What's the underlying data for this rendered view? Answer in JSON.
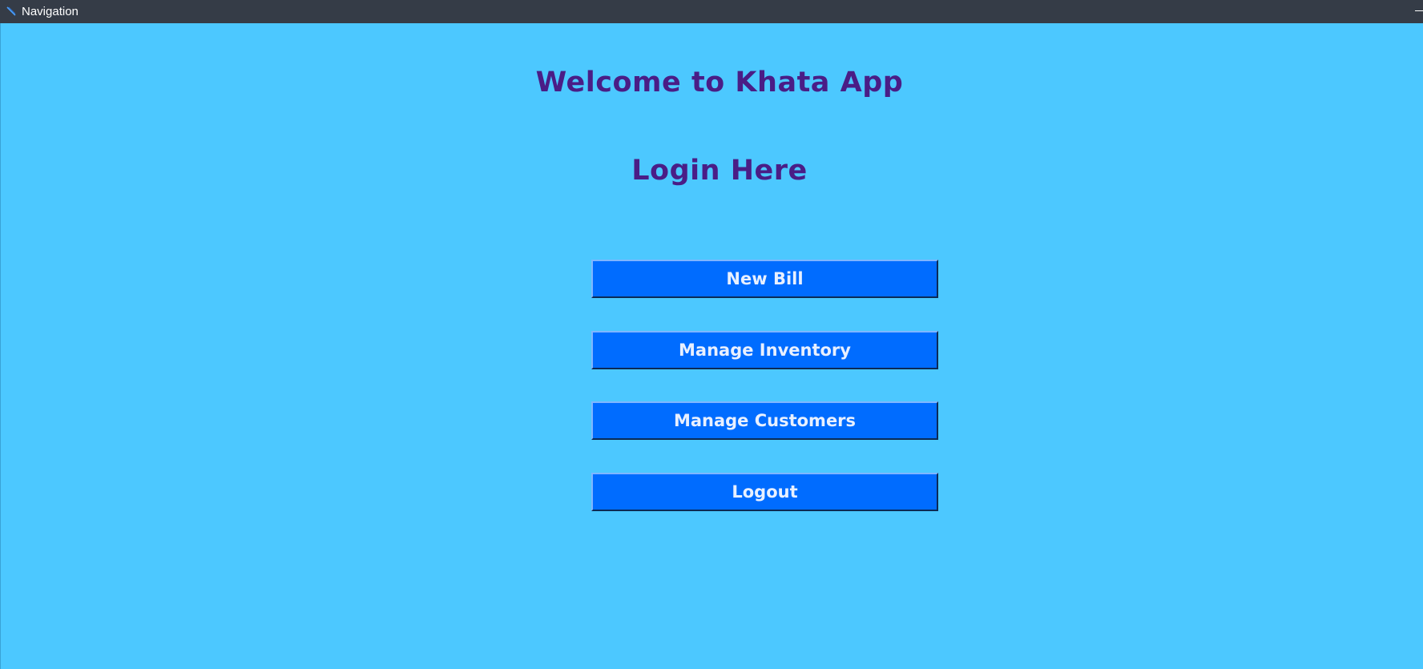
{
  "window": {
    "title": "Navigation",
    "icon": "feather-pen-icon"
  },
  "main": {
    "welcome_text": "Welcome to Khata App",
    "login_text": "Login Here"
  },
  "buttons": {
    "new_bill": "New Bill",
    "manage_inventory": "Manage Inventory",
    "manage_customers": "Manage Customers",
    "logout": "Logout"
  },
  "colors": {
    "background": "#4cc8ff",
    "titlebar": "#353c47",
    "heading": "#4a1d86",
    "button": "#006cff",
    "button_text": "#e8f0ff"
  }
}
